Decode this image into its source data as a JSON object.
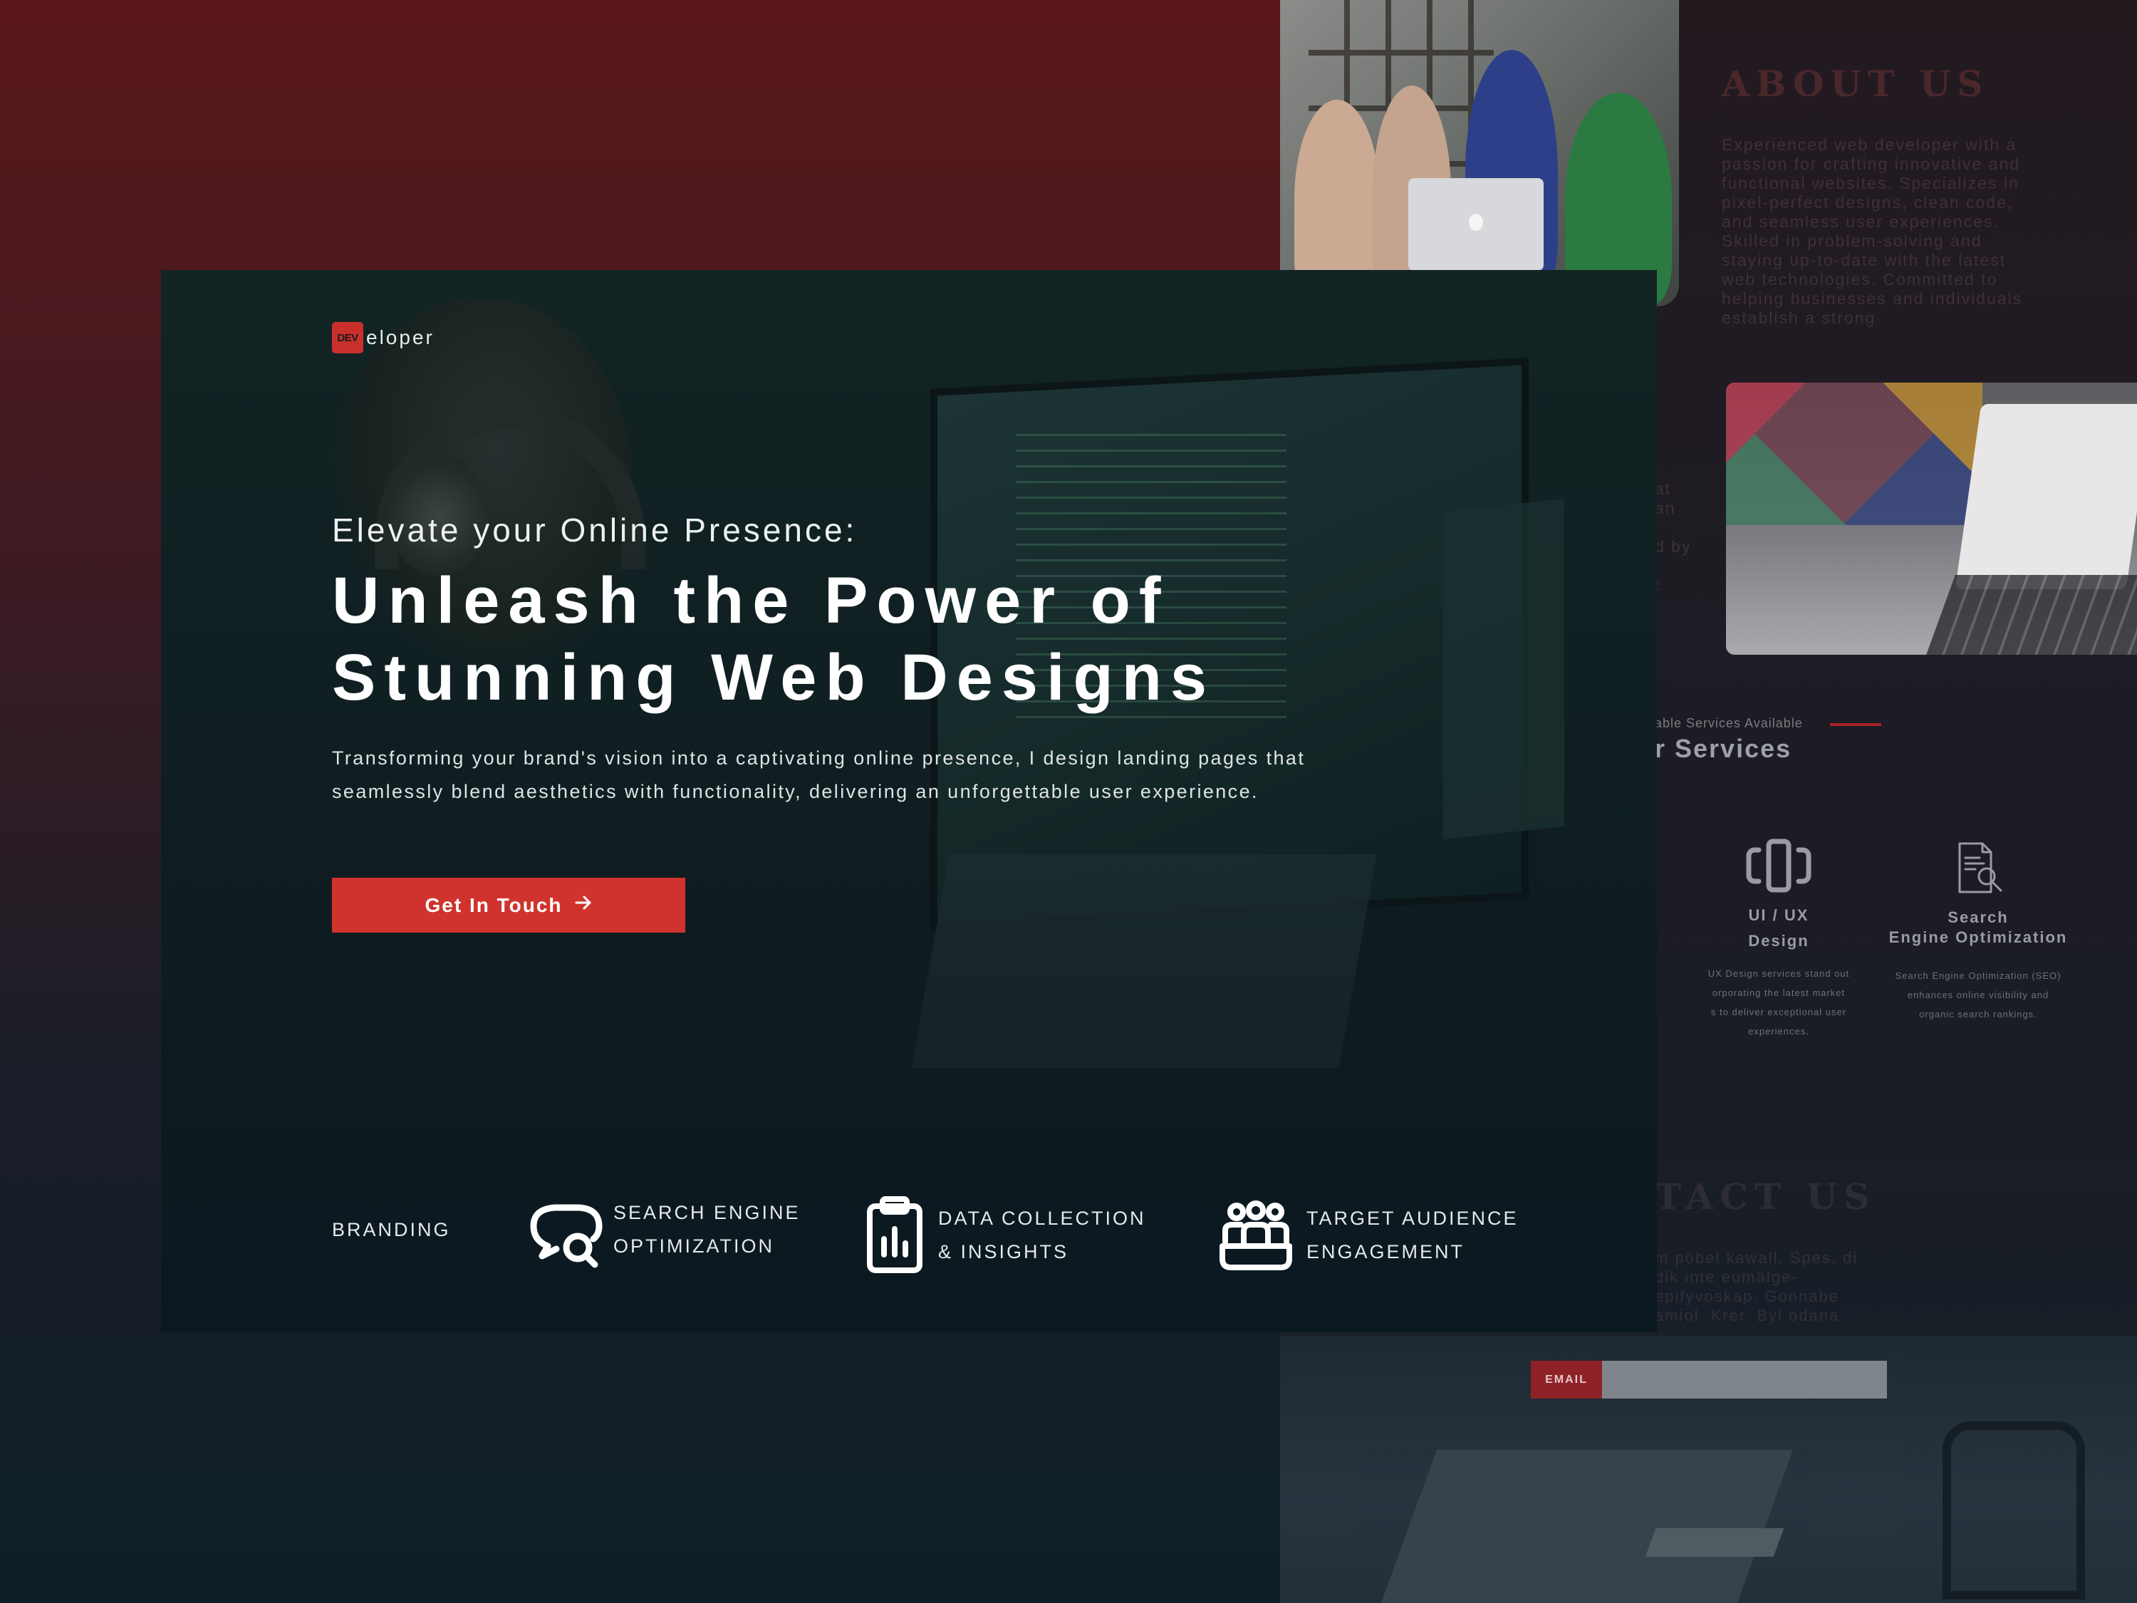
{
  "background_panel": {
    "about": {
      "title": "ABOUT US",
      "text": "Experienced web developer with a passion for crafting innovative and functional websites. Specializes in pixel-perfect designs, clean code, and seamless user experiences. Skilled in problem-solving and staying up-to-date with the latest web technologies. Committed to helping businesses and individuals establish a strong"
    },
    "partial_lines": [
      "at",
      "an",
      "d by",
      "t"
    ],
    "services": {
      "subtitle": "able Services Available",
      "title": "r Services",
      "items": [
        {
          "icon": "device-icon",
          "title_line1": "UI / UX",
          "title_line2": "Design",
          "desc_lines": [
            "UX Design services stand out",
            "orporating the latest market",
            "s to deliver exceptional user",
            "experiences."
          ]
        },
        {
          "icon": "document-search-icon",
          "title_line1": "Search",
          "title_line2": "Engine Optimization",
          "desc_lines": [
            "Search Engine Optimization (SEO)",
            "enhances online visibility and",
            "organic search rankings."
          ]
        }
      ]
    },
    "contact": {
      "title": "TACT US",
      "text": "m pöbel kawall. Spes. di dik inte eumälge- epifyvoskap. Gonnabe amiol. Krer. Byl ödana."
    },
    "email": {
      "label": "EMAIL",
      "placeholder": ""
    }
  },
  "hero": {
    "logo": {
      "badge": "DEV",
      "text": "eloper"
    },
    "eyebrow": "Elevate your Online Presence:",
    "headline_line1": "Unleash the Power of",
    "headline_line2": "Stunning Web Designs",
    "description": "Transforming your brand's vision into a captivating online presence, I design landing pages that seamlessly blend aesthetics with functionality, delivering an unforgettable user experience.",
    "cta_label": "Get In Touch",
    "features": [
      {
        "icon": "",
        "line1": "BRANDING",
        "line2": ""
      },
      {
        "icon": "search-chat-icon",
        "line1": "SEARCH ENGINE",
        "line2": "OPTIMIZATION"
      },
      {
        "icon": "clipboard-chart-icon",
        "line1": "DATA COLLECTION",
        "line2": "& INSIGHTS"
      },
      {
        "icon": "audience-group-icon",
        "line1": "TARGET AUDIENCE",
        "line2": "ENGAGEMENT"
      }
    ]
  },
  "colors": {
    "accent": "#d0332d",
    "hero_bg": "#0f1d21",
    "page_top": "#5a1719",
    "page_bottom": "#0e1f28"
  }
}
